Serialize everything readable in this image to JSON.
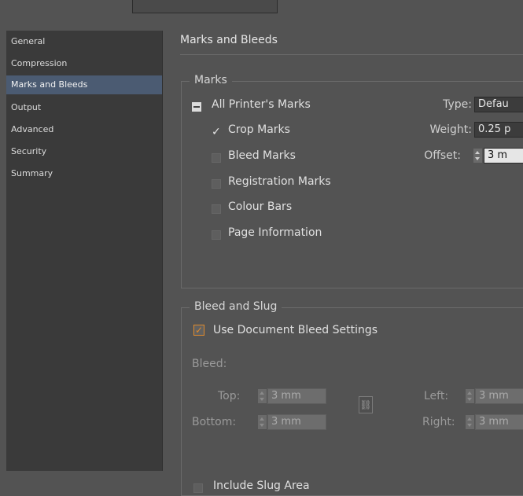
{
  "sidebar": {
    "items": [
      {
        "label": "General"
      },
      {
        "label": "Compression"
      },
      {
        "label": "Marks and Bleeds"
      },
      {
        "label": "Output"
      },
      {
        "label": "Advanced"
      },
      {
        "label": "Security"
      },
      {
        "label": "Summary"
      }
    ],
    "active_index": 2
  },
  "panel": {
    "title": "Marks and Bleeds"
  },
  "marks": {
    "legend": "Marks",
    "all_printers_marks": {
      "label": "All Printer's Marks",
      "state": "mixed"
    },
    "crop_marks": {
      "label": "Crop Marks",
      "checked": true
    },
    "bleed_marks": {
      "label": "Bleed Marks",
      "checked": false
    },
    "registration_marks": {
      "label": "Registration Marks",
      "checked": false
    },
    "colour_bars": {
      "label": "Colour Bars",
      "checked": false
    },
    "page_information": {
      "label": "Page Information",
      "checked": false
    },
    "type": {
      "label": "Type:",
      "value": "Defau"
    },
    "weight": {
      "label": "Weight:",
      "value": "0.25 p"
    },
    "offset": {
      "label": "Offset:",
      "value": "3 m"
    }
  },
  "bleed_slug": {
    "legend": "Bleed and Slug",
    "use_document_bleed": {
      "label": "Use Document Bleed Settings",
      "checked": true
    },
    "bleed_label": "Bleed:",
    "top": {
      "label": "Top:",
      "value": "3 mm"
    },
    "bottom": {
      "label": "Bottom:",
      "value": "3 mm"
    },
    "left": {
      "label": "Left:",
      "value": "3 mm"
    },
    "right": {
      "label": "Right:",
      "value": "3 mm"
    },
    "include_slug": {
      "label": "Include Slug Area",
      "checked": false
    }
  },
  "colors": {
    "accent": "#e08a2c",
    "sidebar_active": "#4b5b72",
    "background": "#535353"
  },
  "icons": {
    "chain": "link-icon"
  }
}
